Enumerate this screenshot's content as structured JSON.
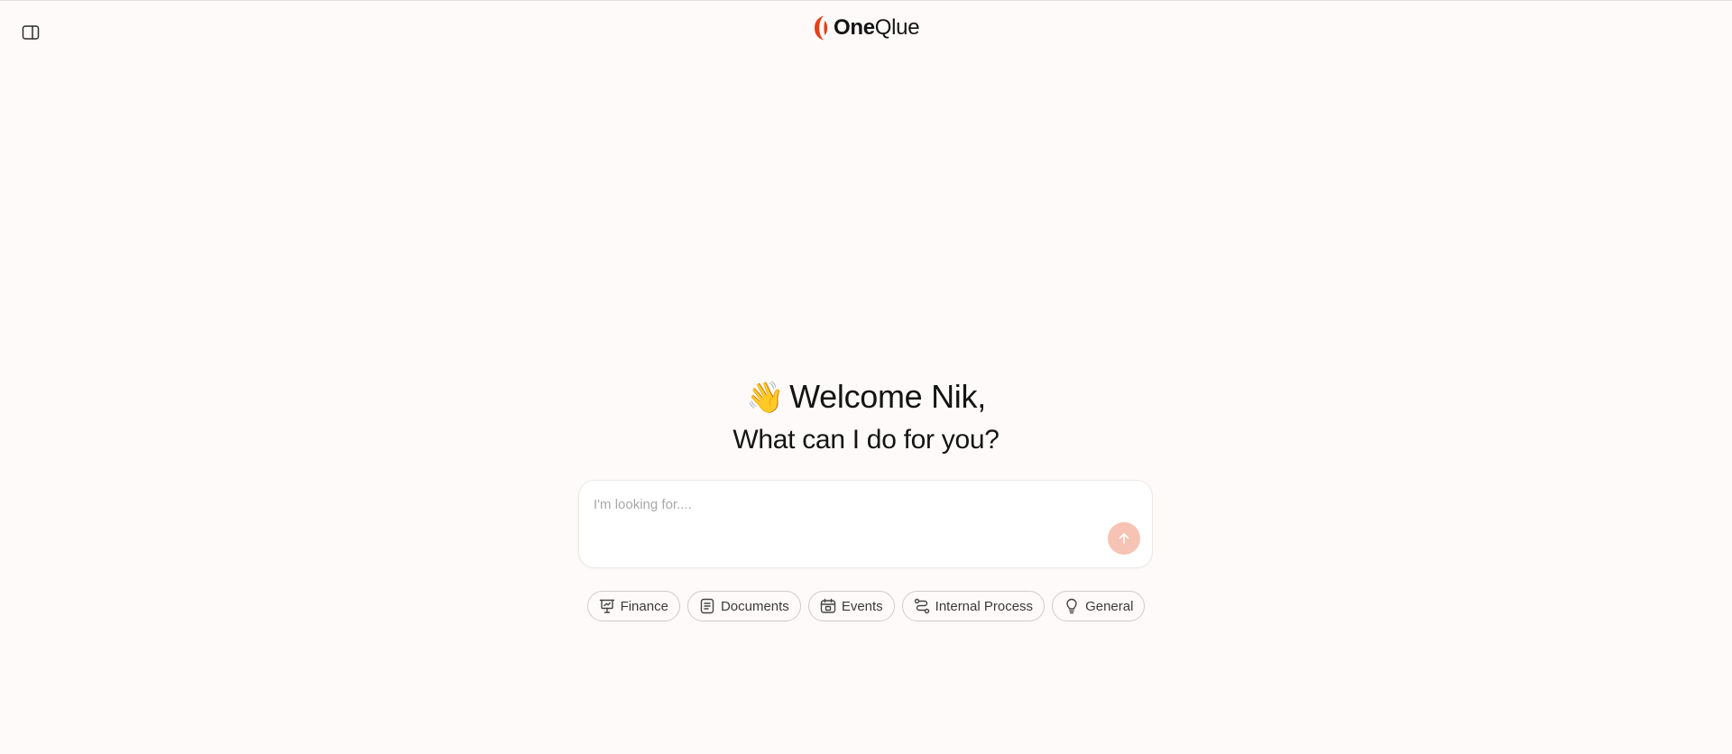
{
  "header": {
    "logo_text_bold": "One",
    "logo_text_regular": "Qlue",
    "sidebar_toggle_icon": "sidebar-panel-icon"
  },
  "hero": {
    "wave_emoji": "👋",
    "welcome": "Welcome Nik,",
    "subtitle": "What can I do for you?"
  },
  "search": {
    "placeholder": "I'm looking for....",
    "value": "",
    "send_icon": "arrow-up-icon"
  },
  "chips": [
    {
      "label": "Finance",
      "icon": "presentation-icon"
    },
    {
      "label": "Documents",
      "icon": "document-icon"
    },
    {
      "label": "Events",
      "icon": "calendar-icon"
    },
    {
      "label": "Internal Process",
      "icon": "route-icon"
    },
    {
      "label": "General",
      "icon": "lightbulb-icon"
    }
  ],
  "colors": {
    "background": "#fefaf9",
    "brand_accent": "#e8401c",
    "send_button": "#f7c3b4"
  }
}
